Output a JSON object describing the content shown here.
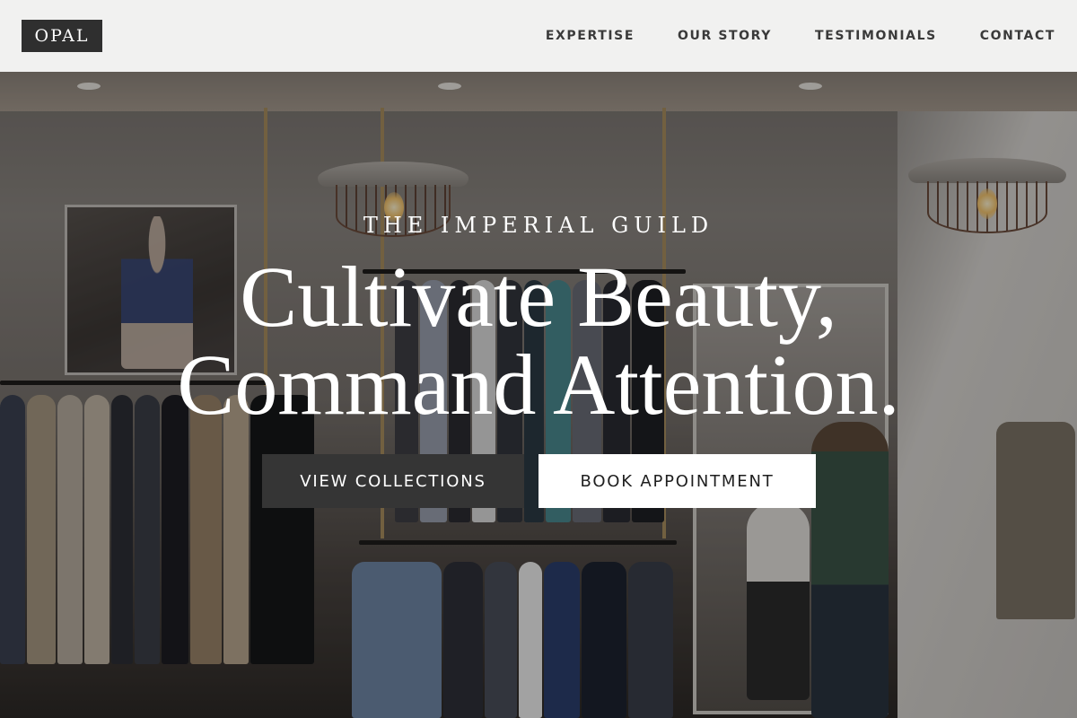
{
  "header": {
    "logo": "OPAL",
    "nav": [
      "EXPERTISE",
      "OUR STORY",
      "TESTIMONIALS",
      "CONTACT"
    ]
  },
  "hero": {
    "eyebrow": "THE IMPERIAL GUILD",
    "headline_line1": "Cultivate Beauty,",
    "headline_line2": "Command Attention.",
    "primary_button": "VIEW COLLECTIONS",
    "secondary_button": "BOOK APPOINTMENT",
    "background_image": "boutique clothing store interior with hanging clothes and pendant lamps"
  },
  "colors": {
    "header_bg": "#f1f1f0",
    "logo_bg": "#2f2f2f",
    "nav_text": "#3a3a3a",
    "hero_text": "#ffffff",
    "primary_button_bg": "#353535",
    "secondary_button_bg": "#ffffff"
  }
}
